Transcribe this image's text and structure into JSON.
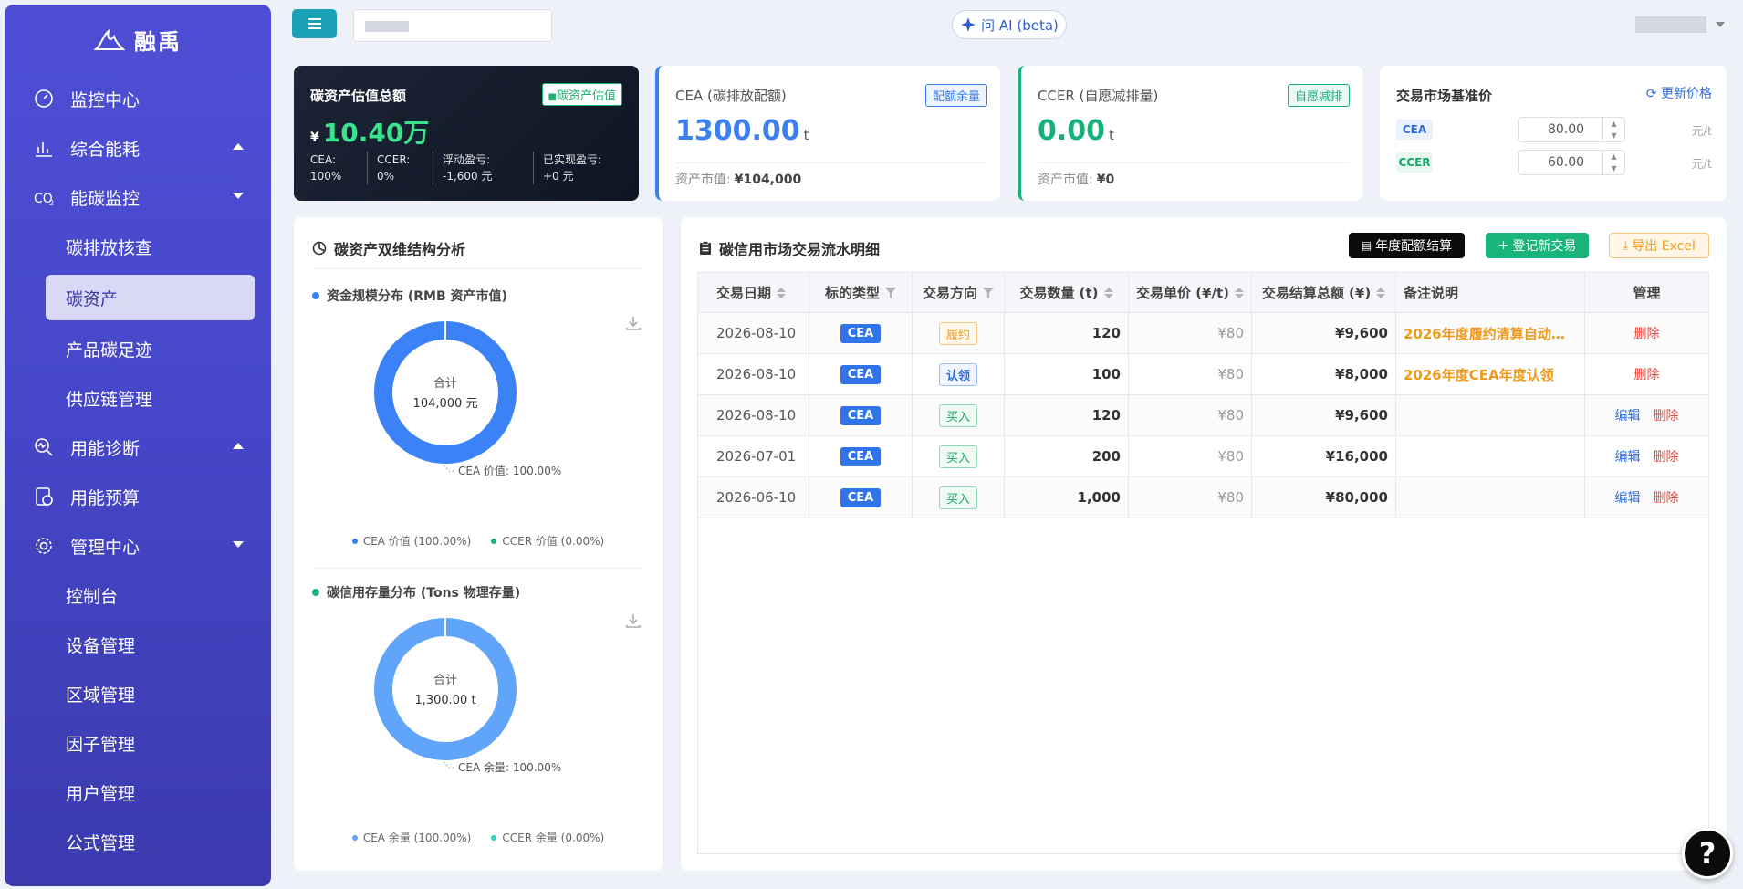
{
  "brand": {
    "name": "融禹"
  },
  "sidebar": {
    "items": [
      {
        "label": "监控中心",
        "icon": "gauge-icon"
      },
      {
        "label": "综合能耗",
        "icon": "chart-icon",
        "caret": "up"
      },
      {
        "label": "能碳监控",
        "icon": "co2-icon",
        "caret": "down",
        "children": [
          "碳排放核查",
          "碳资产",
          "产品碳足迹",
          "供应链管理"
        ]
      },
      {
        "label": "用能诊断",
        "icon": "diagnose-icon",
        "caret": "up"
      },
      {
        "label": "用能预算",
        "icon": "budget-icon"
      },
      {
        "label": "管理中心",
        "icon": "gear-icon",
        "caret": "down",
        "children": [
          "控制台",
          "设备管理",
          "区域管理",
          "因子管理",
          "用户管理",
          "公式管理"
        ]
      }
    ],
    "active": "碳资产"
  },
  "topbar": {
    "ai_label": "问 AI (beta)"
  },
  "card_total": {
    "title": "碳资产估值总额",
    "tag": "碳资产估值",
    "currency": "¥",
    "value": "10.40万",
    "stats": [
      "CEA: 100%",
      "CCER: 0%",
      "浮动盈亏: -1,600 元",
      "已实现盈亏: +0 元"
    ]
  },
  "card_cea": {
    "title": "CEA (碳排放配额)",
    "tag": "配额余量",
    "value": "1300.00",
    "unit": "t",
    "mv_label": "资产市值:",
    "mv_value": "¥104,000"
  },
  "card_ccer": {
    "title": "CCER (自愿减排量)",
    "tag": "自愿减排",
    "value": "0.00",
    "unit": "t",
    "mv_label": "资产市值:",
    "mv_value": "¥0"
  },
  "card_price": {
    "title": "交易市场基准价",
    "refresh": "更新价格",
    "rows": [
      {
        "label": "CEA",
        "value": "80.00",
        "unit": "元/t"
      },
      {
        "label": "CCER",
        "value": "60.00",
        "unit": "元/t"
      }
    ]
  },
  "left_panel": {
    "title": "碳资产双维结构分析",
    "section1": {
      "title": "资金规模分布 (RMB 资产市值)",
      "center_label": "合计",
      "center_value": "104,000 元",
      "annotation": "CEA 价值: 100.00%",
      "legend": [
        "CEA 价值 (100.00%)",
        "CCER 价值 (0.00%)"
      ]
    },
    "section2": {
      "title": "碳信用存量分布 (Tons 物理存量)",
      "center_label": "合计",
      "center_value": "1,300.00 t",
      "annotation": "CEA 余量: 100.00%",
      "legend": [
        "CEA 余量 (100.00%)",
        "CCER 余量 (0.00%)"
      ]
    }
  },
  "chart_data": [
    {
      "type": "pie",
      "title": "资金规模分布 (RMB 资产市值)",
      "categories": [
        "CEA 价值",
        "CCER 价值"
      ],
      "values": [
        104000,
        0
      ],
      "colors": [
        "#3b82f6",
        "#18b47b"
      ]
    },
    {
      "type": "pie",
      "title": "碳信用存量分布 (Tons 物理存量)",
      "categories": [
        "CEA 余量",
        "CCER 余量"
      ],
      "values": [
        1300,
        0
      ],
      "colors": [
        "#60a5fa",
        "#2dd4bf"
      ]
    }
  ],
  "right_panel": {
    "title": "碳信用市场交易流水明细",
    "buttons": {
      "annual": "年度配额结算",
      "register": "登记新交易",
      "export": "导出 Excel"
    },
    "columns": [
      "交易日期",
      "标的类型",
      "交易方向",
      "交易数量 (t)",
      "交易单价 (¥/t)",
      "交易结算总额 (¥)",
      "备注说明",
      "管理"
    ],
    "rows": [
      {
        "date": "2026-08-10",
        "type": "CEA",
        "dir": "履约",
        "dir_style": "o",
        "qty": "120",
        "price": "¥80",
        "total": "¥9,600",
        "note": "2026年度履约清算自动扣减...",
        "edit": "",
        "del": "删除"
      },
      {
        "date": "2026-08-10",
        "type": "CEA",
        "dir": "认领",
        "dir_style": "b",
        "qty": "100",
        "price": "¥80",
        "total": "¥8,000",
        "note": "2026年度CEA年度认领",
        "edit": "",
        "del": "删除"
      },
      {
        "date": "2026-08-10",
        "type": "CEA",
        "dir": "买入",
        "dir_style": "g",
        "qty": "120",
        "price": "¥80",
        "total": "¥9,600",
        "note": "",
        "edit": "编辑",
        "del": "删除"
      },
      {
        "date": "2026-07-01",
        "type": "CEA",
        "dir": "买入",
        "dir_style": "g",
        "qty": "200",
        "price": "¥80",
        "total": "¥16,000",
        "note": "",
        "edit": "编辑",
        "del": "删除"
      },
      {
        "date": "2026-06-10",
        "type": "CEA",
        "dir": "买入",
        "dir_style": "g",
        "qty": "1,000",
        "price": "¥80",
        "total": "¥80,000",
        "note": "",
        "edit": "编辑",
        "del": "删除"
      }
    ]
  },
  "help": "?"
}
